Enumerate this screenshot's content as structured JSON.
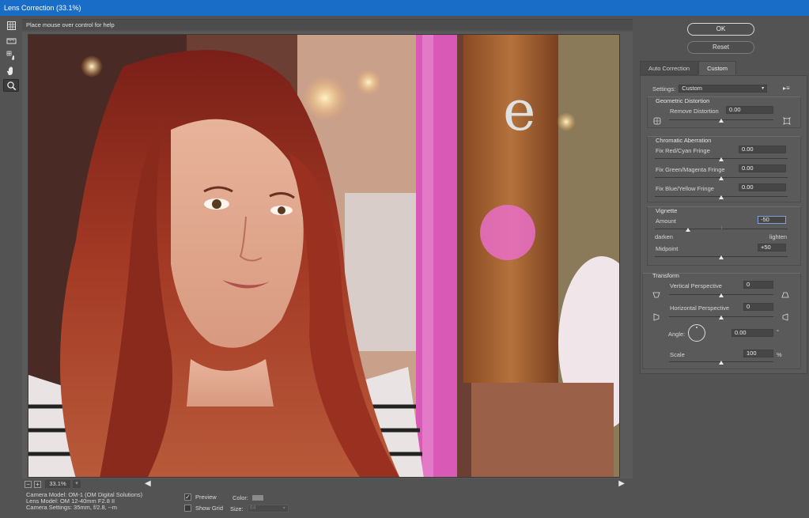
{
  "window": {
    "title": "Lens Correction (33.1%)"
  },
  "tools": [
    {
      "name": "remove-distortion-tool-icon"
    },
    {
      "name": "straighten-tool-icon"
    },
    {
      "name": "move-grid-tool-icon"
    },
    {
      "name": "hand-tool-icon"
    },
    {
      "name": "zoom-tool-icon",
      "active": true
    }
  ],
  "help": {
    "text": "Place mouse over control for help"
  },
  "canvas": {
    "zoom_out": "−",
    "zoom_in": "+",
    "zoom": "33.1%"
  },
  "camera_info": {
    "model": "Camera Model: OM-1 (OM Digital Solutions)",
    "lens": "Lens Model: OM 12-40mm F2.8 II",
    "settings": "Camera Settings: 35mm, f/2.8, --m"
  },
  "bottom_options": {
    "preview_label": "Preview",
    "preview_checked": true,
    "show_grid_label": "Show Grid",
    "show_grid_checked": false,
    "color_label": "Color:",
    "size_label": "Size:",
    "size_value": "64"
  },
  "buttons": {
    "ok": "OK",
    "reset": "Reset"
  },
  "tabs": [
    {
      "label": "Auto Correction",
      "active": false
    },
    {
      "label": "Custom",
      "active": true
    }
  ],
  "custom": {
    "settings_label": "Settings:",
    "settings_value": "Custom",
    "geometric": {
      "title": "Geometric Distortion",
      "remove_distortion_label": "Remove Distortion",
      "remove_distortion_value": "0.00"
    },
    "chromatic": {
      "title": "Chromatic Aberration",
      "red_cyan_label": "Fix Red/Cyan Fringe",
      "red_cyan_value": "0.00",
      "green_magenta_label": "Fix Green/Magenta Fringe",
      "green_magenta_value": "0.00",
      "blue_yellow_label": "Fix Blue/Yellow Fringe",
      "blue_yellow_value": "0.00"
    },
    "vignette": {
      "title": "Vignette",
      "amount_label": "Amount",
      "amount_value": "-50",
      "darken_label": "darken",
      "lighten_label": "lighten",
      "midpoint_label": "Midpoint",
      "midpoint_value": "+50"
    },
    "transform": {
      "title": "Transform",
      "vertical_label": "Vertical Perspective",
      "vertical_value": "0",
      "horizontal_label": "Horizontal Perspective",
      "horizontal_value": "0",
      "angle_label": "Angle:",
      "angle_value": "0.00",
      "angle_unit": "°",
      "scale_label": "Scale",
      "scale_value": "100",
      "scale_unit": "%"
    }
  }
}
